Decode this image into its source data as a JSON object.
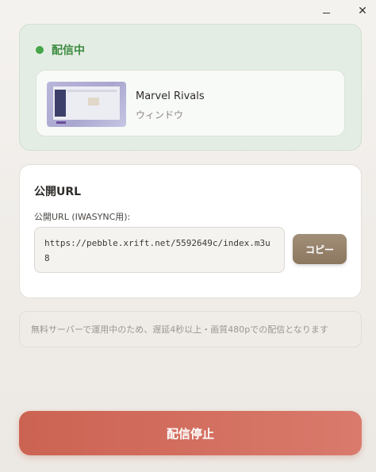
{
  "window": {
    "minimize_icon": "minimize-icon",
    "close_icon": "close-icon",
    "close_glyph": "✕"
  },
  "status": {
    "label": "配信中",
    "indicator_color": "#46a64a"
  },
  "source": {
    "name": "Marvel Rivals",
    "type": "ウィンドウ"
  },
  "public_url": {
    "title": "公開URL",
    "field_label": "公開URL (IWASYNC用):",
    "value": "https://pebble.xrift.net/5592649c/index.m3u8",
    "copy_label": "コピー"
  },
  "notice": {
    "text": "無料サーバーで運用中のため、遅延4秒以上・画質480pでの配信となります"
  },
  "actions": {
    "stop_label": "配信停止",
    "stop_color": "#cc6352"
  }
}
